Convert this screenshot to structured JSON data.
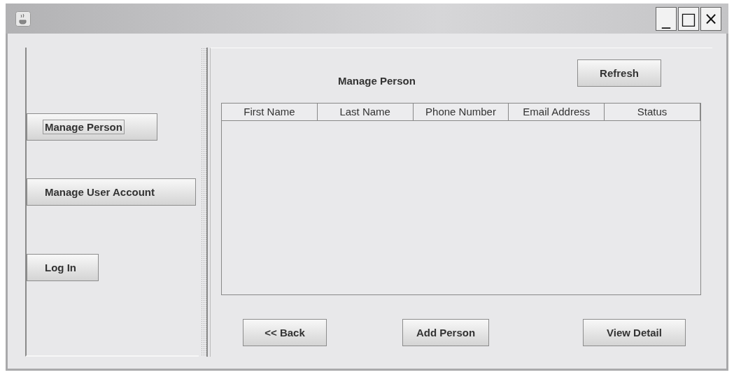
{
  "window": {
    "controls": [
      "_",
      "□",
      "×"
    ]
  },
  "sidebar": {
    "buttons": [
      {
        "label": "Manage Person",
        "focused": true
      },
      {
        "label": "Manage User Account",
        "focused": false
      },
      {
        "label": "Log In",
        "focused": false
      }
    ]
  },
  "main": {
    "title": "Manage Person",
    "refresh": "Refresh",
    "table": {
      "columns": [
        "First Name",
        "Last Name",
        "Phone Number",
        "Email Address",
        "Status"
      ]
    },
    "buttons": [
      "<< Back",
      "Add Person",
      "View Detail"
    ]
  }
}
